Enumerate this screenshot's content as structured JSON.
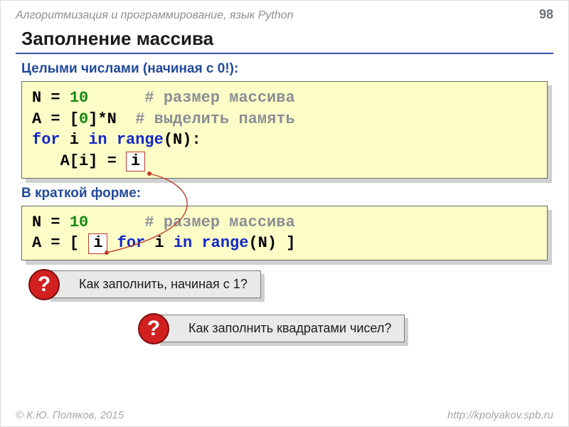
{
  "header": {
    "course": "Алгоритмизация и программирование, язык Python",
    "page_number": "98"
  },
  "title": "Заполнение массива",
  "block1": {
    "heading": "Целыми числами (начиная с 0!):",
    "line1_a": "N = ",
    "line1_num": "10",
    "line1_cmt": "      # размер массива",
    "line2_a": "A = [",
    "line2_num": "0",
    "line2_b": "]*N  ",
    "line2_cmt": "# выделить память",
    "line3_a": "for",
    "line3_b": " i ",
    "line3_c": "in",
    "line3_d": " range",
    "line3_e": "(N):",
    "line4_a": "   A[i] = ",
    "token": "i"
  },
  "block2": {
    "heading": "В краткой форме:",
    "line1_a": "N = ",
    "line1_num": "10",
    "line1_cmt": "      # размер массива",
    "line2_a": "A = [ ",
    "token": "i",
    "line2_b": " ",
    "line2_c": "for",
    "line2_d": " i ",
    "line2_e": "in",
    "line2_f": " range",
    "line2_g": "(N) ]"
  },
  "q1": {
    "mark": "?",
    "text": "Как заполнить, начиная с 1?"
  },
  "q2": {
    "mark": "?",
    "text": "Как заполнить квадратами чисел?"
  },
  "footer": {
    "left": "© К.Ю. Поляков, 2015",
    "right": "http://kpolyakov.spb.ru"
  }
}
